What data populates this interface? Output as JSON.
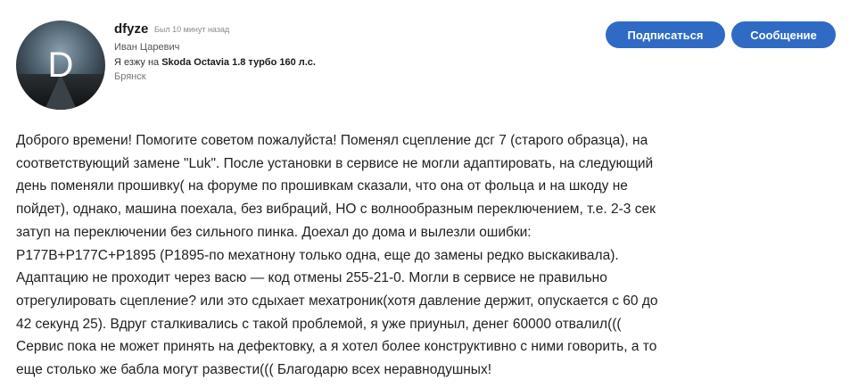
{
  "profile": {
    "avatar_letter": "D",
    "username": "dfyze",
    "last_seen": "Был 10 минут назад",
    "real_name": "Иван Царевич",
    "car_prefix": "Я езжу на",
    "car_model": "Skoda Octavia 1.8 турбо 160 л.с.",
    "city": "Брянск"
  },
  "actions": {
    "subscribe_label": "Подписаться",
    "message_label": "Сообщение"
  },
  "post": {
    "lines": [
      "Доброго времени! Помогите советом пожалуйста! Поменял сцепление дсг 7 (старого образца), на",
      "соответствующий замене \"Luk\". После установки в сервисе не могли адаптировать, на следующий",
      "день поменяли прошивку( на форуме по прошивкам сказали, что она от фольца и на шкоду не",
      "пойдет), однако, машина поехала, без вибраций, НО с волнообразным переключением, т.е. 2-3 сек",
      "затуп на переключении без сильного пинка. Доехал до дома и вылезли ошибки:",
      "P177B+P177C+P1895 (P1895-по мехатнону только одна, еще до замены редко выскакивала).",
      "Адаптацию не проходит через васю — код отмены 255-21-0. Могли в сервисе не правильно",
      "отрегулировать сцепление? или это сдыхает мехатроник(хотя давление держит, опускается с 60 до",
      "42 секунд 25). Вдруг сталкивались с такой проблемой, я уже приуныл, денег 60000 отвалил(((",
      "Сервис пока не может принять на дефектовку, а я хотел более конструктивно с ними говорить, а то",
      "еще столько же бабла могут развести((( Благодарю всех неравнодушных!"
    ]
  },
  "colors": {
    "button_bg": "#2f6bc5",
    "button_text": "#ffffff"
  }
}
